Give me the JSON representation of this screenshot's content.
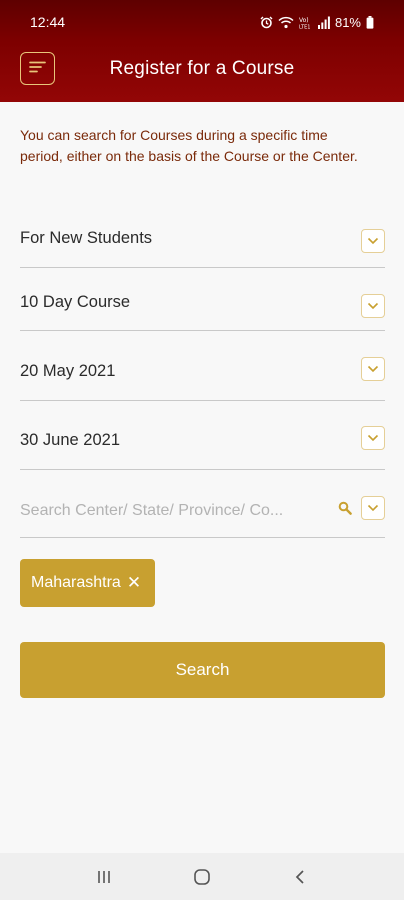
{
  "status_bar": {
    "time": "12:44",
    "battery": "81%",
    "icons": [
      "alarm-icon",
      "wifi-icon",
      "volte-icon",
      "signal-icon",
      "battery-icon"
    ]
  },
  "app_bar": {
    "title": "Register for a Course",
    "menu_icon": "menu-icon"
  },
  "intro_text": "You can search for Courses during a specific time period, either on the basis of the Course or the Center.",
  "fields": {
    "student_type": "For New Students",
    "course_type": "10 Day Course",
    "start_date": "20 May 2021",
    "end_date": "30 June 2021",
    "center_search_placeholder": "Search Center/ State/ Province/ Co..."
  },
  "selected_chip": {
    "label": "Maharashtra",
    "remove": "✕"
  },
  "search_button": "Search",
  "colors": {
    "header": "#7d0000",
    "accent": "#c8a030",
    "intro_text": "#7a2a0a"
  },
  "nav_bar": [
    "recent-apps-icon",
    "home-icon",
    "back-icon"
  ]
}
